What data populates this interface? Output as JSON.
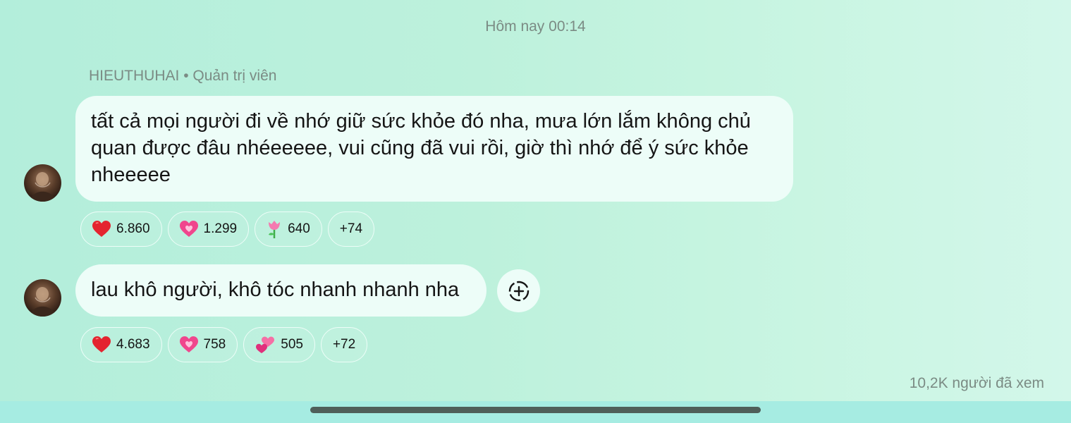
{
  "timestamp": "Hôm nay 00:14",
  "sender": {
    "name": "HIEUTHUHAI",
    "separator": "•",
    "role": "Quản trị viên"
  },
  "messages": [
    {
      "text": "tất cả mọi người đi về nhớ giữ sức khỏe đó nha, mưa lớn lắm không chủ quan được đâu nhéeeeee, vui cũng đã vui rồi, giờ thì nhớ để ý sức khỏe nheeeee",
      "reactions": [
        {
          "icon": "red-heart-icon",
          "count": "6.860"
        },
        {
          "icon": "pink-heart-icon",
          "count": "1.299"
        },
        {
          "icon": "tulip-icon",
          "count": "640"
        }
      ],
      "more": "+74"
    },
    {
      "text": "lau khô người, khô tóc nhanh nhanh nha",
      "reactions": [
        {
          "icon": "red-heart-icon",
          "count": "4.683"
        },
        {
          "icon": "pink-heart-icon",
          "count": "758"
        },
        {
          "icon": "two-hearts-icon",
          "count": "505"
        }
      ],
      "more": "+72"
    }
  ],
  "views": "10,2K người đã xem",
  "colors": {
    "background": "#b3eedb",
    "bubble": "#edfdf8",
    "meta_text": "#7b8b84",
    "bottom_strip": "#a6ece2",
    "home_indicator": "#4f5f5a"
  }
}
